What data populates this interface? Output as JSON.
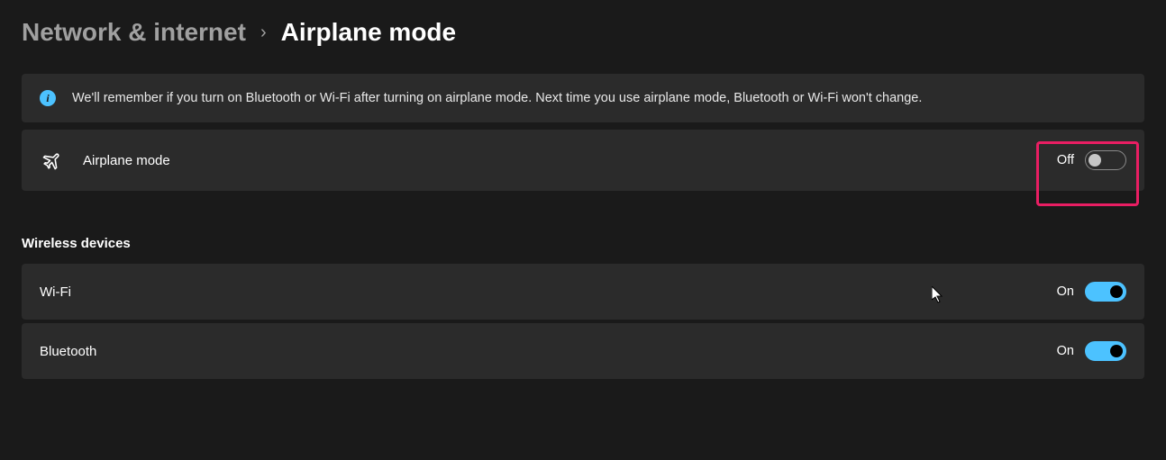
{
  "breadcrumb": {
    "parent": "Network & internet",
    "separator": "›",
    "current": "Airplane mode"
  },
  "info": {
    "text": "We'll remember if you turn on Bluetooth or Wi-Fi after turning on airplane mode. Next time you use airplane mode, Bluetooth or Wi-Fi won't change."
  },
  "airplane": {
    "label": "Airplane mode",
    "state": "Off"
  },
  "section": {
    "title": "Wireless devices"
  },
  "wifi": {
    "label": "Wi-Fi",
    "state": "On"
  },
  "bluetooth": {
    "label": "Bluetooth",
    "state": "On"
  }
}
